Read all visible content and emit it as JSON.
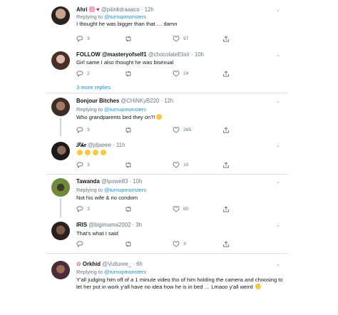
{
  "tweets": [
    {
      "name": "Ahri",
      "handle": "@piiinkdraaaco",
      "time": "12h",
      "reply_prefix": "Replying to",
      "reply_to": "@turnupmonsters",
      "text": "I thought he was bigger than that…. damn",
      "replies": "3",
      "retweets": "",
      "likes": "97"
    },
    {
      "name": "FOLLOW @masteryofself1",
      "handle": "@chocolateElixir",
      "time": "10h",
      "text": "Girl same I also thought he was bisexual",
      "replies": "2",
      "retweets": "",
      "likes": "24",
      "more_replies": "3 more replies"
    },
    {
      "name": "Bonjour Bitches",
      "handle": "@CHiNKyB220",
      "time": "12h",
      "reply_prefix": "Replying to",
      "reply_to": "@turnupmonsters",
      "text": "Who grandparents bed they on?!",
      "replies": "3",
      "retweets": "",
      "likes": "285"
    },
    {
      "name": "𝒮𝒽𝑒",
      "handle": "@jdjaeee",
      "time": "11h",
      "text": "",
      "replies": "3",
      "retweets": "",
      "likes": "10"
    },
    {
      "name": "Tawanda",
      "handle": "@tpowe83",
      "time": "10h",
      "reply_prefix": "Replying to",
      "reply_to": "@turnupmonsters",
      "text": "Not his wife & no condom",
      "replies": "3",
      "retweets": "",
      "likes": "80"
    },
    {
      "name": "IRIS",
      "handle": "@bigimama2002",
      "time": "3h",
      "text": "That's what I said",
      "replies": "",
      "retweets": "",
      "likes": "3"
    },
    {
      "name": "Orkhid",
      "handle": "@Vulturee_",
      "time": "6h",
      "reply_prefix": "Replying to",
      "reply_to": "@turnupmonsters",
      "text": "Y'all judging him off of a 1 minute video tho of him holding the camera and choosing to let her put in work y'all have no idea how he is in bed … Lmaoo y'all weird",
      "replies": "",
      "retweets": "",
      "likes": ""
    }
  ],
  "separator": " · ",
  "colors": {
    "link": "#1b95e0",
    "meta": "#657786",
    "divider": "#dfe3e8"
  },
  "icons": [
    "reply-icon",
    "retweet-icon",
    "like-icon",
    "share-icon",
    "chevron-down-icon",
    "laughing-emoji-icon",
    "heart-eyes-emoji-icon",
    "red-heart-emoji-icon",
    "flower-emoji-icon",
    "grimace-emoji-icon"
  ]
}
